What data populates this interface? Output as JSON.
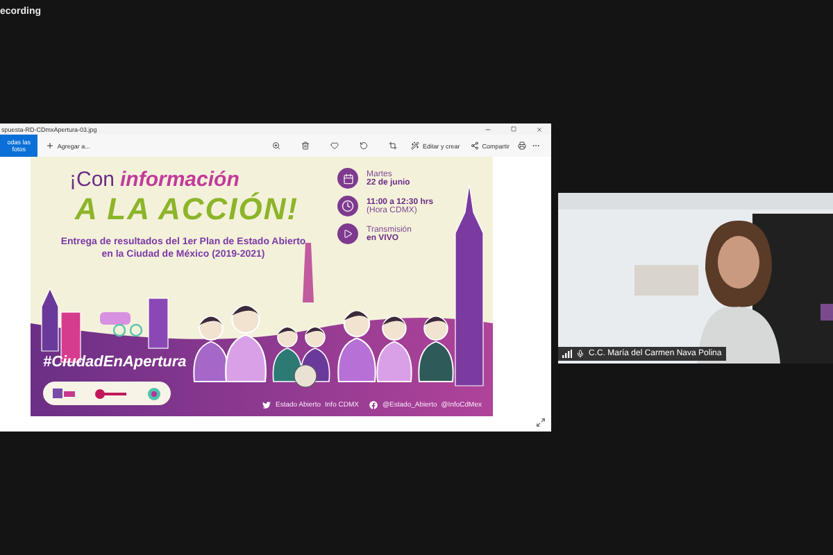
{
  "recording": {
    "label": "ecording"
  },
  "viewer": {
    "title": "spuesta-RD-CDmxApertura-03.jpg",
    "back_button": "odas las fotos",
    "add_button": "Agregar a...",
    "edit_button": "Editar y crear",
    "share_button": "Compartir"
  },
  "poster": {
    "headline_lead": "¡Con",
    "headline_accent": "información",
    "headline_main": "A LA ACCIÓN!",
    "subtitle": "Entrega de resultados del 1er Plan de Estado Abierto en la Ciudad de México (2019-2021)",
    "details": [
      {
        "kind": "calendar",
        "lines": [
          {
            "text": "Martes",
            "bold": false
          },
          {
            "text": "22 de junio",
            "bold": true
          }
        ]
      },
      {
        "kind": "clock",
        "lines": [
          {
            "text": "11:00 a 12:30 hrs",
            "bold": true
          },
          {
            "text": "(Hora CDMX)",
            "bold": false
          }
        ]
      },
      {
        "kind": "play",
        "lines": [
          {
            "text": "Transmisión",
            "bold": false
          },
          {
            "text": "en VIVO",
            "bold": true
          }
        ]
      }
    ],
    "hashtag": "#CiudadEnApertura",
    "social": [
      {
        "kind": "twitter",
        "handles": [
          "Estado Abierto",
          "Info CDMX"
        ]
      },
      {
        "kind": "facebook",
        "handles": [
          "@Estado_Abierto",
          "@InfoCdMex"
        ]
      }
    ]
  },
  "participant": {
    "name": "C.C. María del Carmen Nava Polina"
  }
}
